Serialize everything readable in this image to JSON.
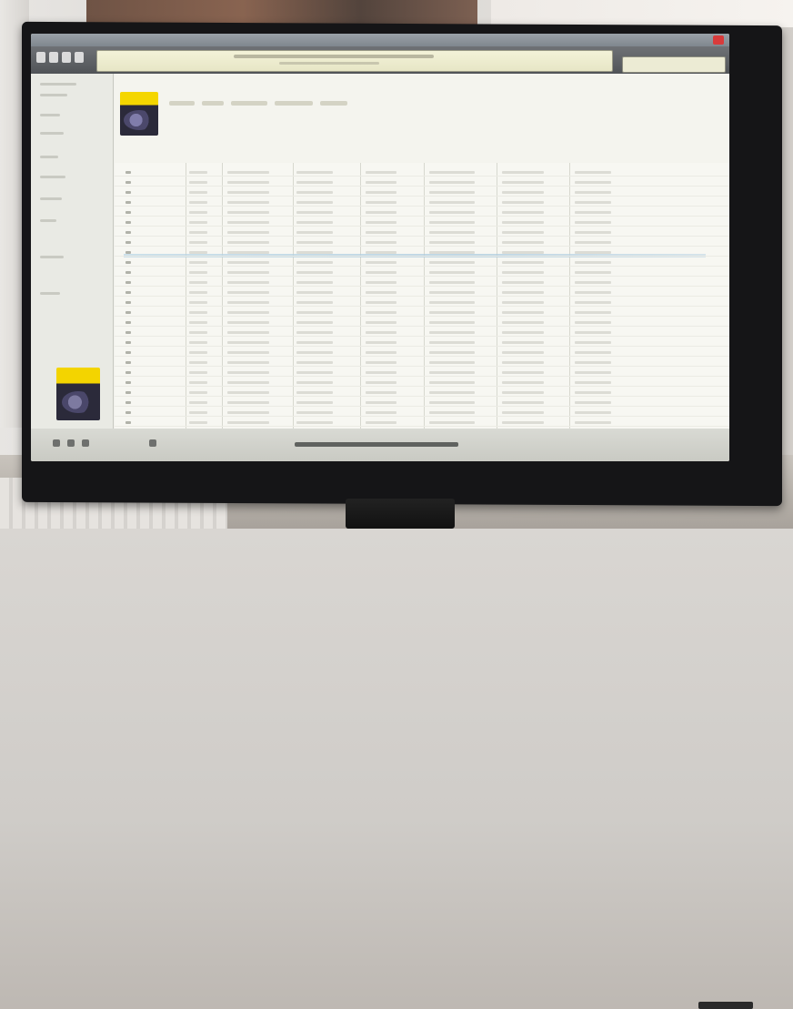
{
  "scene": {
    "description_free": true
  },
  "app": {
    "title": "",
    "now_playing": "",
    "search_placeholder": ""
  },
  "sidebar": {
    "items": [
      "",
      "",
      "",
      "",
      "",
      "",
      "",
      "",
      "",
      ""
    ]
  },
  "header": {
    "tabs": [
      "",
      "",
      "",
      "",
      ""
    ]
  },
  "table": {
    "row_count": 26,
    "highlighted_row": 8
  },
  "colors": {
    "lcd": "#f3f2d8",
    "toolbar": "#505357",
    "album_yellow": "#f3d400",
    "selection": "#a8c9de",
    "close_button": "#d83b3b"
  }
}
